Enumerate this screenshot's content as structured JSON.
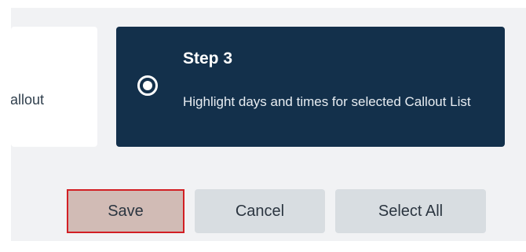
{
  "steps": {
    "previous": {
      "label_fragment": "Callout"
    },
    "current": {
      "title": "Step 3",
      "description": "Highlight days and times for selected Callout List",
      "selected": true
    }
  },
  "buttons": {
    "save": "Save",
    "cancel": "Cancel",
    "select_all": "Select All"
  },
  "colors": {
    "active_card_bg": "#13304b",
    "save_highlight_border": "#d21f24",
    "save_bg": "#d1bbb5",
    "button_bg": "#d8dde1"
  }
}
